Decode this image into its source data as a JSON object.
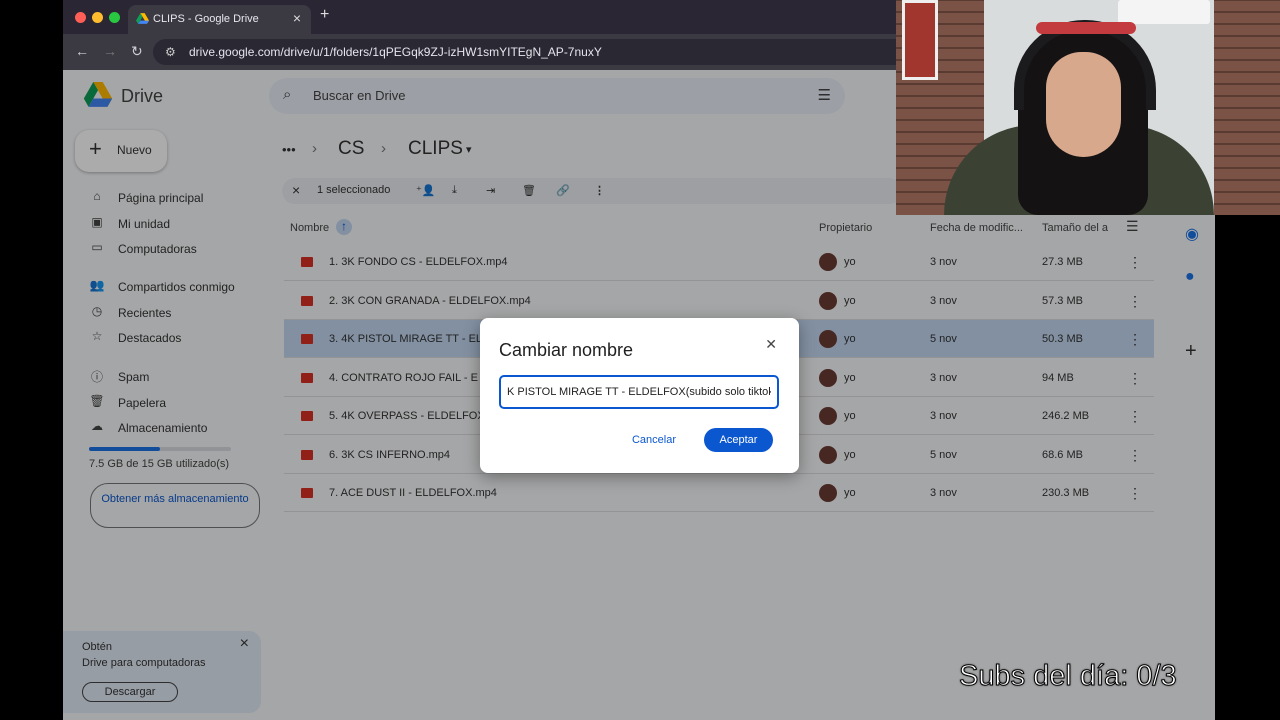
{
  "browser": {
    "tab_title": "CLIPS - Google Drive",
    "url": "drive.google.com/drive/u/1/folders/1qPEGqk9ZJ-izHW1smYITEgN_AP-7nuxY"
  },
  "drive": {
    "logo_text": "Drive",
    "search_placeholder": "Buscar en Drive",
    "new_label": "Nuevo",
    "nav": [
      {
        "label": "Página principal",
        "icon": "home-icon"
      },
      {
        "label": "Mi unidad",
        "icon": "drive-icon"
      },
      {
        "label": "Computadoras",
        "icon": "computer-icon"
      },
      {
        "label": "Compartidos conmigo",
        "icon": "people-icon"
      },
      {
        "label": "Recientes",
        "icon": "clock-icon"
      },
      {
        "label": "Destacados",
        "icon": "star-icon"
      },
      {
        "label": "Spam",
        "icon": "spam-icon"
      },
      {
        "label": "Papelera",
        "icon": "trash-icon"
      },
      {
        "label": "Almacenamiento",
        "icon": "cloud-icon"
      }
    ],
    "storage": {
      "text": "7.5 GB de 15 GB utilizado(s)",
      "used_fraction": 0.5
    },
    "get_more": "Obtener más almacenamiento",
    "promo": {
      "line1": "Obtén",
      "line2": "Drive para computadoras",
      "button": "Descargar"
    },
    "breadcrumb": {
      "ellipsis": "•••",
      "parent": "CS",
      "current": "CLIPS"
    },
    "selection": {
      "count_label": "1 seleccionado"
    },
    "columns": {
      "name": "Nombre",
      "owner": "Propietario",
      "modified": "Fecha de modific...",
      "size": "Tamaño del a"
    },
    "files": [
      {
        "name": "1. 3K FONDO CS - ELDELFOX.mp4",
        "owner": "yo",
        "date": "3 nov",
        "size": "27.3 MB",
        "selected": false
      },
      {
        "name": "2. 3K CON GRANADA - ELDELFOX.mp4",
        "owner": "yo",
        "date": "3 nov",
        "size": "57.3 MB",
        "selected": false
      },
      {
        "name": "3. 4K PISTOL MIRAGE TT - EL",
        "owner": "yo",
        "date": "5 nov",
        "size": "50.3 MB",
        "selected": true
      },
      {
        "name": "4. CONTRATO ROJO FAIL - E",
        "owner": "yo",
        "date": "3 nov",
        "size": "94 MB",
        "selected": false
      },
      {
        "name": "5. 4K OVERPASS - ELDELFOX",
        "owner": "yo",
        "date": "3 nov",
        "size": "246.2 MB",
        "selected": false
      },
      {
        "name": "6. 3K CS INFERNO.mp4",
        "owner": "yo",
        "date": "5 nov",
        "size": "68.6 MB",
        "selected": false
      },
      {
        "name": "7. ACE DUST II - ELDELFOX.mp4",
        "owner": "yo",
        "date": "3 nov",
        "size": "230.3 MB",
        "selected": false
      }
    ]
  },
  "dialog": {
    "title": "Cambiar nombre",
    "value": "K PISTOL MIRAGE TT - ELDELFOX(subido solo tiktok",
    "cancel": "Cancelar",
    "ok": "Aceptar"
  },
  "overlay": {
    "subs": "Subs del día: 0/3"
  },
  "colors": {
    "accent": "#0b57d0",
    "selected_row": "#c2d7f2",
    "video_icon": "#d93025"
  }
}
